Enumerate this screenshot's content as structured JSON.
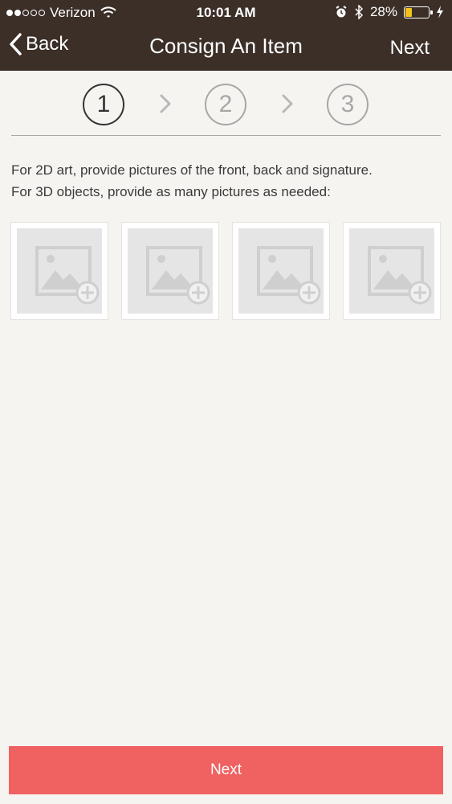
{
  "status_bar": {
    "carrier": "Verizon",
    "time": "10:01 AM",
    "battery": "28%",
    "battery_level": 0.28,
    "signal_bars": 2,
    "signal_total": 5
  },
  "nav": {
    "back_label": "Back",
    "title": "Consign An Item",
    "next_label": "Next"
  },
  "steps": [
    {
      "label": "1",
      "active": true
    },
    {
      "label": "2",
      "active": false
    },
    {
      "label": "3",
      "active": false
    }
  ],
  "instructions": {
    "line1": "For 2D art, provide pictures of the front, back and signature.",
    "line2": "For 3D objects, provide as many pictures as needed:"
  },
  "photo_slots": [
    {
      "icon": "add-image-icon"
    },
    {
      "icon": "add-image-icon"
    },
    {
      "icon": "add-image-icon"
    },
    {
      "icon": "add-image-icon"
    }
  ],
  "footer": {
    "next_label": "Next"
  },
  "colors": {
    "header_bg": "#3b2f28",
    "page_bg": "#f6f4f1",
    "primary_button": "#f06161",
    "battery_fill": "#f3c21b"
  }
}
